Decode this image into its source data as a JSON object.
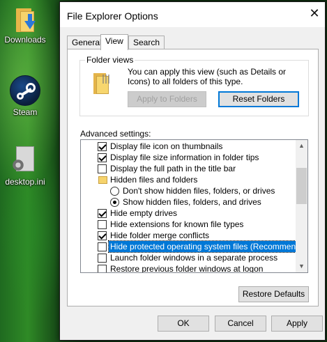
{
  "desktop": {
    "icons": [
      {
        "label": "Downloads",
        "icon": "downloads-folder-icon"
      },
      {
        "label": "Steam",
        "icon": "steam-icon"
      },
      {
        "label": "desktop.ini",
        "icon": "settings-file-icon"
      }
    ]
  },
  "dialog": {
    "title": "File Explorer Options",
    "close_glyph": "✕",
    "tabs": [
      {
        "label": "General",
        "active": false
      },
      {
        "label": "View",
        "active": true
      },
      {
        "label": "Search",
        "active": false
      }
    ],
    "folder_views": {
      "legend": "Folder views",
      "description": "You can apply this view (such as Details or Icons) to all folders of this type.",
      "apply_label": "Apply to Folders",
      "reset_label": "Reset Folders"
    },
    "advanced": {
      "label": "Advanced settings:",
      "items": [
        {
          "kind": "checkbox",
          "checked": true,
          "text": "Display file icon on thumbnails"
        },
        {
          "kind": "checkbox",
          "checked": true,
          "text": "Display file size information in folder tips"
        },
        {
          "kind": "checkbox",
          "checked": false,
          "text": "Display the full path in the title bar"
        },
        {
          "kind": "folder",
          "text": "Hidden files and folders"
        },
        {
          "kind": "radio",
          "checked": false,
          "text": "Don't show hidden files, folders, or drives"
        },
        {
          "kind": "radio",
          "checked": true,
          "text": "Show hidden files, folders, and drives"
        },
        {
          "kind": "checkbox",
          "checked": true,
          "text": "Hide empty drives"
        },
        {
          "kind": "checkbox",
          "checked": false,
          "text": "Hide extensions for known file types"
        },
        {
          "kind": "checkbox",
          "checked": true,
          "text": "Hide folder merge conflicts"
        },
        {
          "kind": "checkbox",
          "checked": false,
          "text": "Hide protected operating system files (Recommended)",
          "selected": true
        },
        {
          "kind": "checkbox",
          "checked": false,
          "text": "Launch folder windows in a separate process"
        },
        {
          "kind": "checkbox",
          "checked": false,
          "text": "Restore previous folder windows at logon"
        }
      ],
      "scroll_up": "▲",
      "scroll_down": "▼"
    },
    "restore_defaults_label": "Restore Defaults",
    "ok_label": "OK",
    "cancel_label": "Cancel",
    "apply_label": "Apply",
    "colors": {
      "accent": "#0078d7",
      "selection": "#0078d7"
    }
  }
}
